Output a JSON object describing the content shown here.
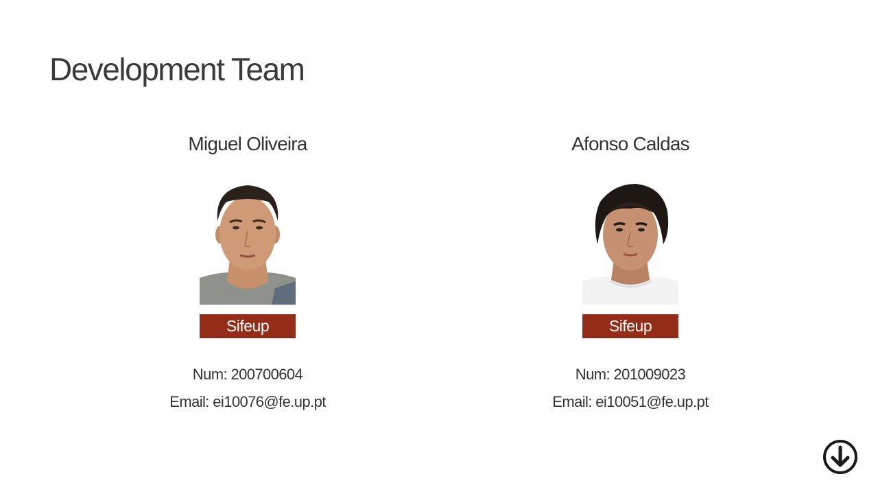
{
  "page": {
    "title": "Development Team"
  },
  "members": [
    {
      "name": "Miguel Oliveira",
      "button_label": "Sifeup",
      "num_text": "Num: 200700604",
      "email_text": "Email: ei10076@fe.up.pt"
    },
    {
      "name": "Afonso Caldas",
      "button_label": "Sifeup",
      "num_text": "Num: 201009023",
      "email_text": "Email: ei10051@fe.up.pt"
    }
  ],
  "colors": {
    "accent": "#932d18",
    "text": "#333333",
    "background": "#ffffff"
  },
  "icons": {
    "down": "arrow-down-circle-icon"
  }
}
